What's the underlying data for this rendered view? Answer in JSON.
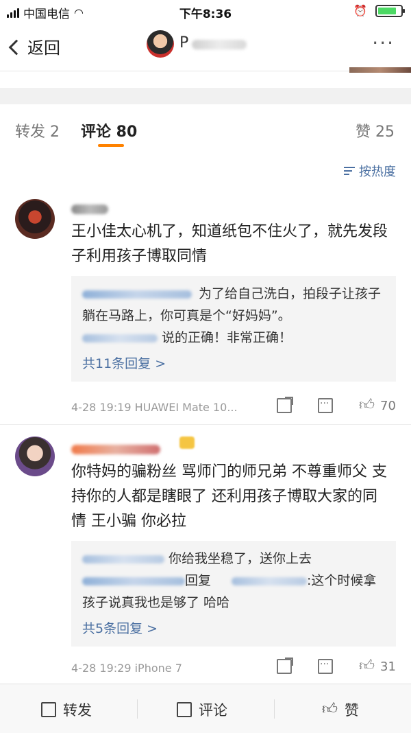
{
  "status_bar": {
    "carrier": "中国电信",
    "time": "下午8:36",
    "battery_level": 0.8
  },
  "nav": {
    "back_label": "返回",
    "user_name_visible": "P",
    "more_label": "···"
  },
  "tabs": {
    "repost": "转发 2",
    "comment": "评论 80",
    "like": "赞 25"
  },
  "sort": {
    "label": "按热度"
  },
  "comments": [
    {
      "text": "王小佳太心机了，知道纸包不住火了，就先发段子利用孩子博取同情",
      "replies": [
        {
          "text": "为了给自己洗白，拍段子让孩子躺在马路上，你可真是个“好妈妈”。"
        },
        {
          "text": "说的正确！非常正确！"
        }
      ],
      "more_replies": "共11条回复 >",
      "meta": "4-28 19:19  HUAWEI Mate 10...",
      "likes": "70"
    },
    {
      "text": "你特妈的骗粉丝 骂师门的师兄弟 不尊重师父 支持你的人都是瞎眼了 还利用孩子博取大家的同情 王小骗 你必拉",
      "replies": [
        {
          "text": "你给我坐稳了，送你上去"
        },
        {
          "text_a": "回复",
          "text_b": ":这个时候拿孩子说真我也是够了 哈哈"
        }
      ],
      "more_replies": "共5条回复 >",
      "meta": "4-28 19:29  iPhone 7",
      "likes": "31"
    }
  ],
  "bottom_bar": {
    "repost": "转发",
    "comment": "评论",
    "like": "赞"
  },
  "colors": {
    "accent": "#ff8200",
    "link": "#4a6fa1"
  }
}
